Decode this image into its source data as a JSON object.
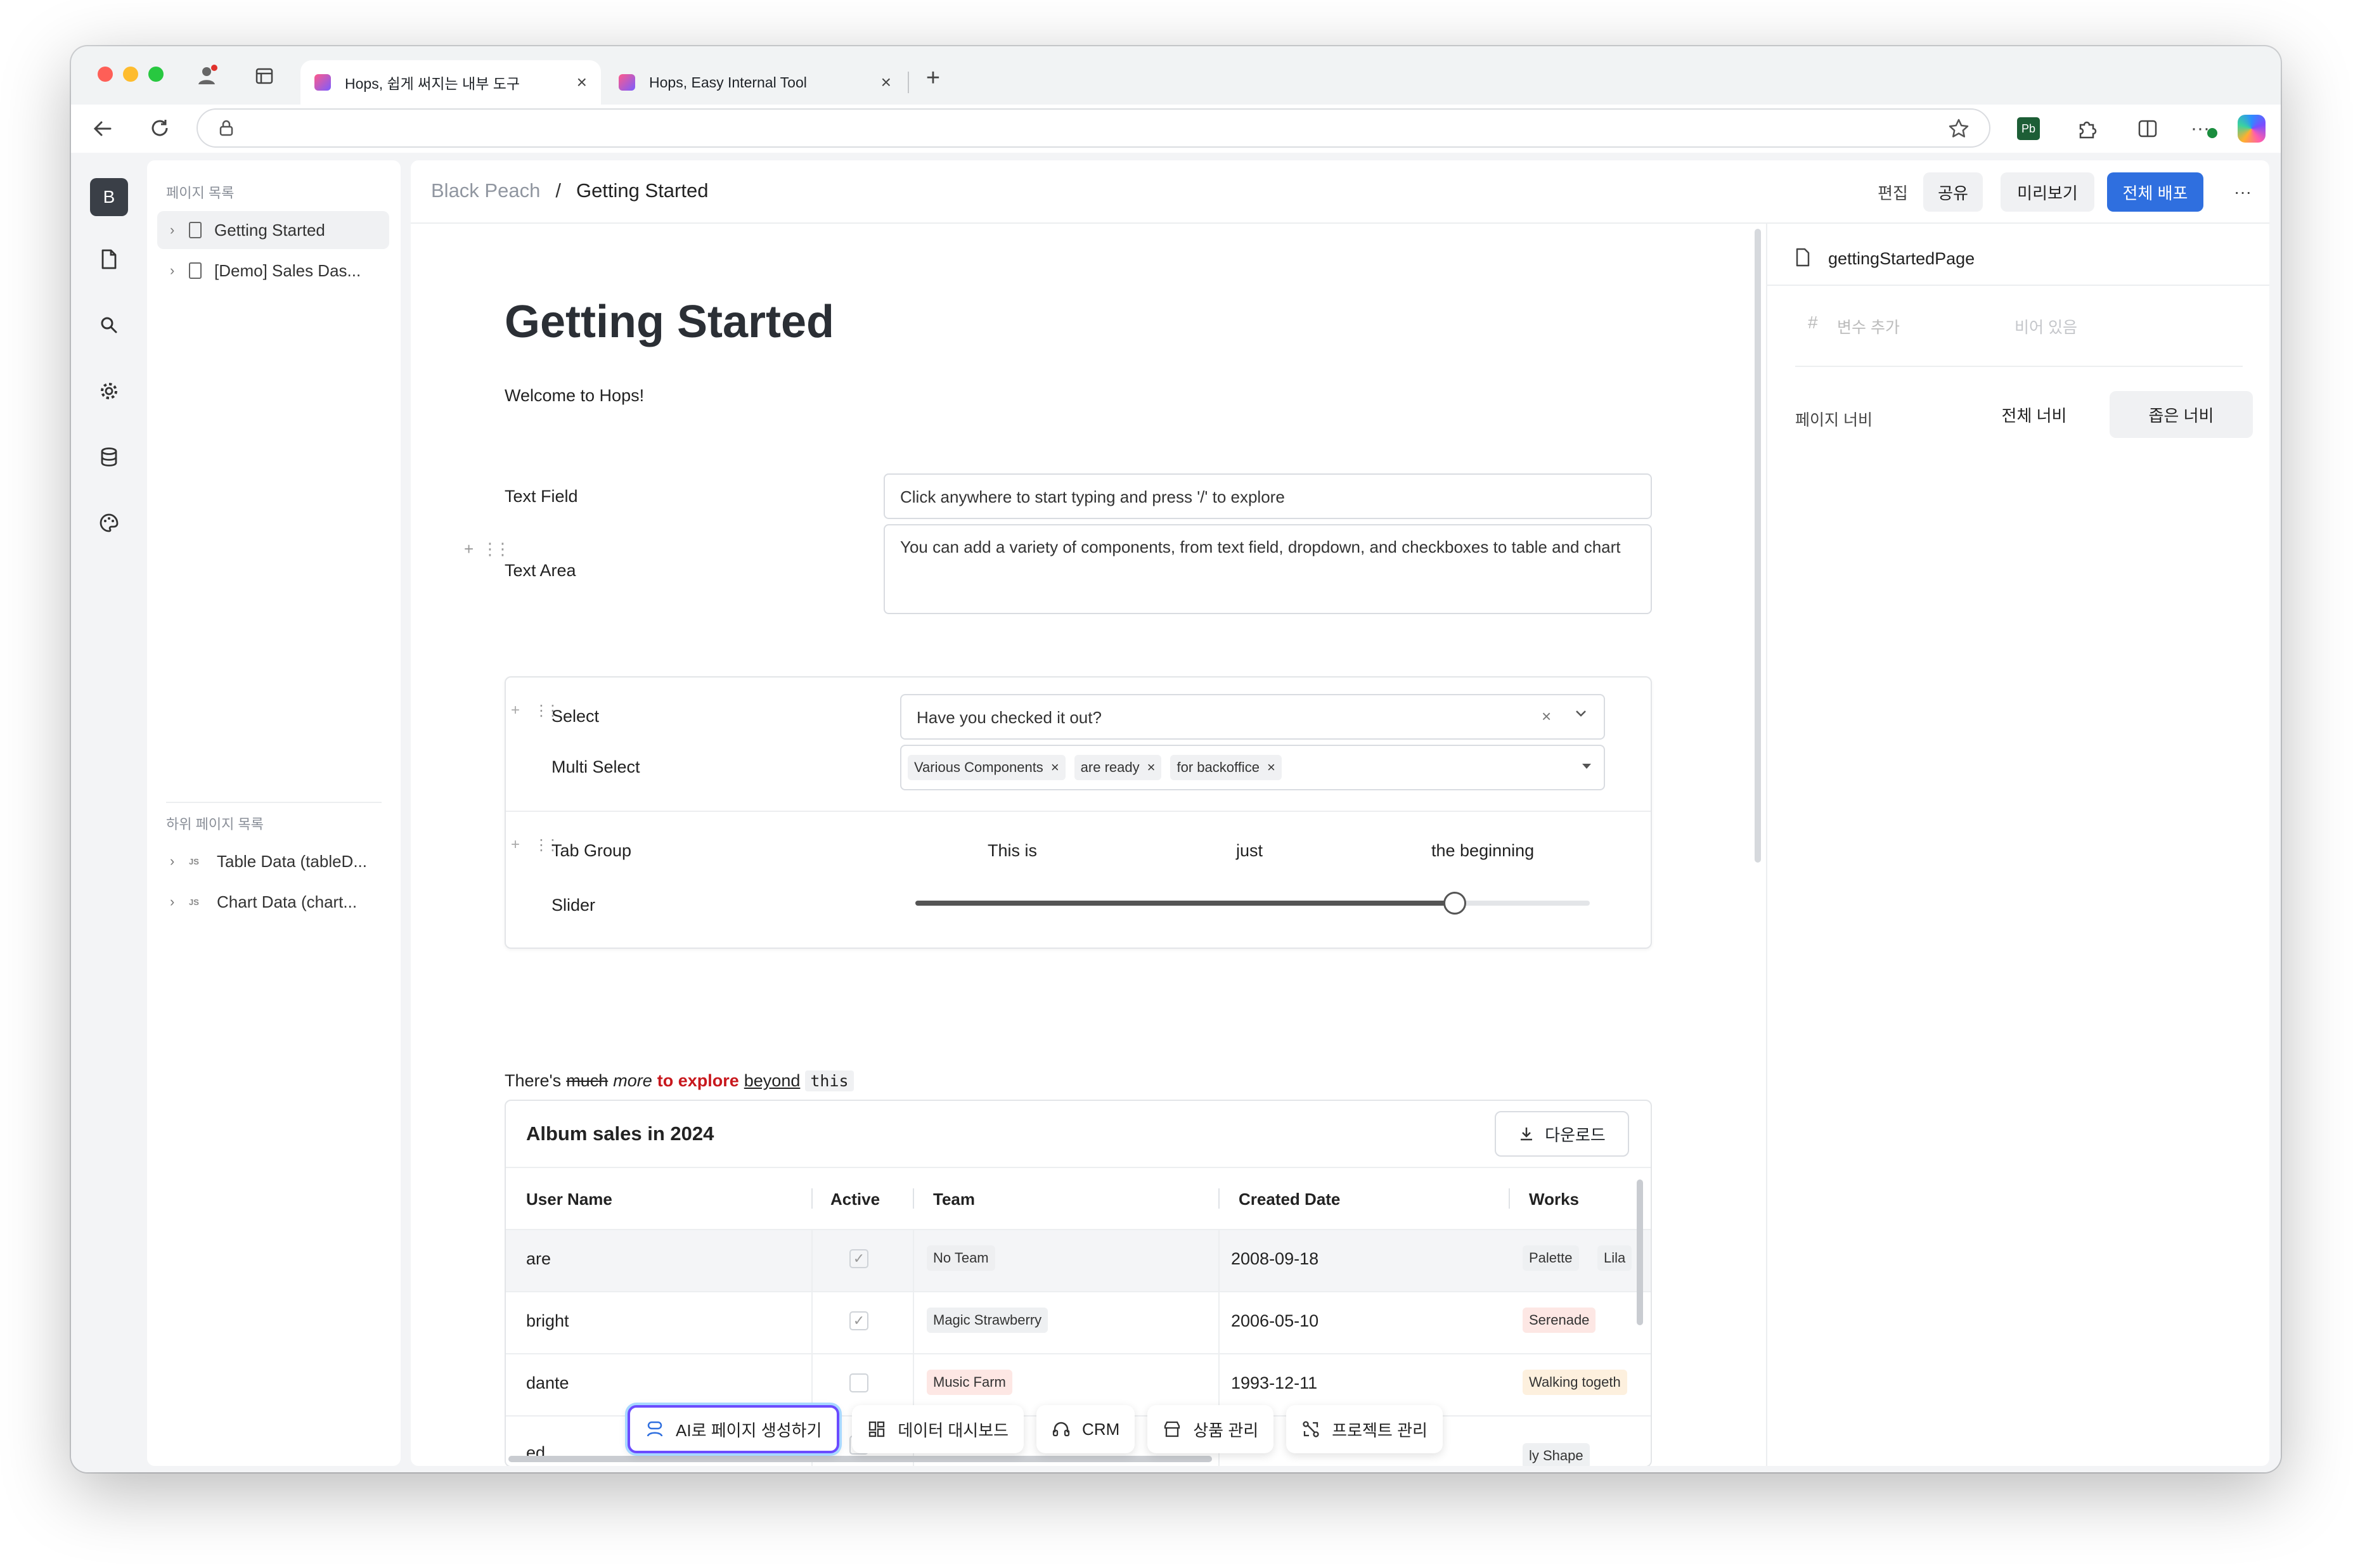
{
  "browser": {
    "tabs": [
      {
        "title": "Hops, 쉽게 써지는 내부 도구",
        "active": true
      },
      {
        "title": "Hops, Easy Internal Tool",
        "active": false
      }
    ],
    "new_tab_icon": "plus-icon"
  },
  "rail": {
    "workspace_initial": "B",
    "icons": [
      "document-icon",
      "search-icon",
      "gear-icon",
      "database-icon",
      "palette-icon"
    ]
  },
  "sidebar": {
    "pages_heading": "페이지 목록",
    "pages": [
      "Getting Started",
      "[Demo] Sales Das..."
    ],
    "subpages_heading": "하위 페이지 목록",
    "subpages": [
      "Table Data (tableD...",
      "Chart Data (chart..."
    ],
    "subpage_badge": "JS"
  },
  "header": {
    "workspace": "Black Peach",
    "separator": "/",
    "page": "Getting Started",
    "edit_label": "편집",
    "share_label": "공유",
    "preview_label": "미리보기",
    "deploy_label": "전체 배포",
    "more_label": "···"
  },
  "page": {
    "title": "Getting Started",
    "welcome": "Welcome to Hops!",
    "text_field": {
      "label": "Text Field",
      "value": "Click anywhere to start typing and press '/' to explore"
    },
    "text_area": {
      "label": "Text Area",
      "value": "You can add a variety of components, from text field, dropdown, and checkboxes to table and chart"
    },
    "select": {
      "label": "Select",
      "value": "Have you checked it out?"
    },
    "multi_select": {
      "label": "Multi Select",
      "chips": [
        "Various Components",
        "are ready",
        "for backoffice"
      ]
    },
    "tab_group": {
      "label": "Tab Group",
      "tabs": [
        "This is",
        "just",
        "the beginning"
      ]
    },
    "slider": {
      "label": "Slider",
      "value_fraction": 0.8
    },
    "rich_text": {
      "plain": "There's",
      "strike": "much",
      "italic": "more",
      "bold_red": "to explore",
      "underline": "beyond",
      "code": "this"
    },
    "table": {
      "title": "Album sales in 2024",
      "download_label": "다운로드",
      "columns": [
        "User Name",
        "Active",
        "Team",
        "Created Date",
        "Works"
      ],
      "rows": [
        {
          "name": "are",
          "active": true,
          "team": "No Team",
          "team_color": "#eeeff1",
          "date": "2008-09-18",
          "works": [
            "Palette",
            "Lila"
          ],
          "works_color": "#eef0f2"
        },
        {
          "name": "bright",
          "active": true,
          "team": "Magic Strawberry",
          "team_color": "#eef0f2",
          "date": "2006-05-10",
          "works": [
            "Serenade"
          ],
          "works_color": "#fde7e4"
        },
        {
          "name": "dante",
          "active": false,
          "team": "Music Farm",
          "team_color": "#fde7e4",
          "date": "1993-12-11",
          "works": [
            "Walking togeth"
          ],
          "works_color": "#fdf0de"
        },
        {
          "name": "ed",
          "active": true,
          "team": "",
          "team_color": "#eeeff1",
          "date": "",
          "works": [
            "ly Shape"
          ],
          "works_color": "#eef0f2"
        }
      ],
      "caption": "table"
    },
    "quick_actions": [
      {
        "label": "AI로 페이지 생성하기",
        "icon": "ai-icon",
        "highlighted": true
      },
      {
        "label": "데이터 대시보드",
        "icon": "dashboard-icon"
      },
      {
        "label": "CRM",
        "icon": "headset-icon"
      },
      {
        "label": "상품 관리",
        "icon": "store-icon"
      },
      {
        "label": "프로젝트 관리",
        "icon": "project-icon"
      }
    ]
  },
  "inspector": {
    "page_name": "gettingStartedPage",
    "add_variable": "변수 추가",
    "empty": "비어 있음",
    "width_label": "페이지 너비",
    "full_width": "전체 너비",
    "narrow_width": "좁은 너비"
  },
  "colors": {
    "accent": "#2f6fdf",
    "danger": "#c8181d",
    "ai_border": "#6b4cff"
  }
}
